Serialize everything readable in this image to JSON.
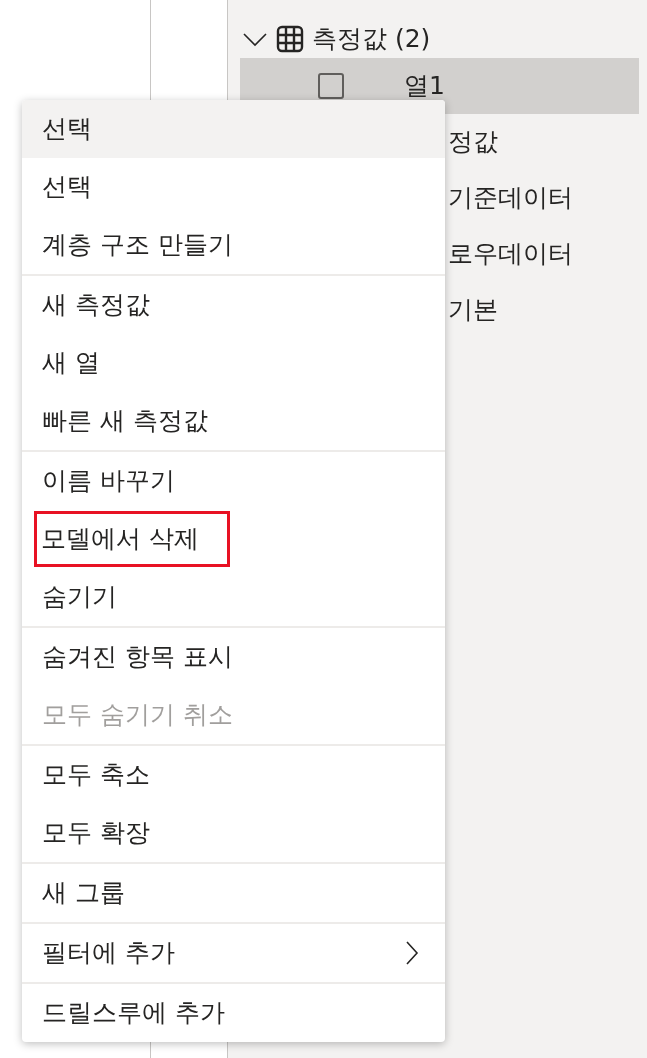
{
  "tree": {
    "group": {
      "label": "측정값 (2)",
      "expanded": true
    },
    "items": [
      {
        "label": "열1",
        "selected": true,
        "checked": false
      },
      {
        "label": "정값",
        "selected": false
      },
      {
        "label": "기준데이터",
        "selected": false
      },
      {
        "label": "로우데이터",
        "selected": false
      },
      {
        "label": "기본",
        "selected": false
      }
    ]
  },
  "context_menu": {
    "header": "선택",
    "groups": [
      [
        {
          "label": "선택",
          "disabled": false,
          "highlighted": false,
          "submenu": false
        },
        {
          "label": "계층 구조 만들기",
          "disabled": false,
          "highlighted": false,
          "submenu": false
        }
      ],
      [
        {
          "label": "새 측정값",
          "disabled": false,
          "highlighted": false,
          "submenu": false
        },
        {
          "label": "새 열",
          "disabled": false,
          "highlighted": false,
          "submenu": false
        },
        {
          "label": "빠른 새 측정값",
          "disabled": false,
          "highlighted": false,
          "submenu": false
        }
      ],
      [
        {
          "label": "이름 바꾸기",
          "disabled": false,
          "highlighted": false,
          "submenu": false
        },
        {
          "label": "모델에서 삭제",
          "disabled": false,
          "highlighted": true,
          "submenu": false
        },
        {
          "label": "숨기기",
          "disabled": false,
          "highlighted": false,
          "submenu": false
        }
      ],
      [
        {
          "label": "숨겨진 항목 표시",
          "disabled": false,
          "highlighted": false,
          "submenu": false
        },
        {
          "label": "모두 숨기기 취소",
          "disabled": true,
          "highlighted": false,
          "submenu": false
        }
      ],
      [
        {
          "label": "모두 축소",
          "disabled": false,
          "highlighted": false,
          "submenu": false
        },
        {
          "label": "모두 확장",
          "disabled": false,
          "highlighted": false,
          "submenu": false
        }
      ],
      [
        {
          "label": "새 그룹",
          "disabled": false,
          "highlighted": false,
          "submenu": false
        }
      ],
      [
        {
          "label": "필터에 추가",
          "disabled": false,
          "highlighted": false,
          "submenu": true
        }
      ],
      [
        {
          "label": "드릴스루에 추가",
          "disabled": false,
          "highlighted": false,
          "submenu": false
        }
      ]
    ]
  }
}
